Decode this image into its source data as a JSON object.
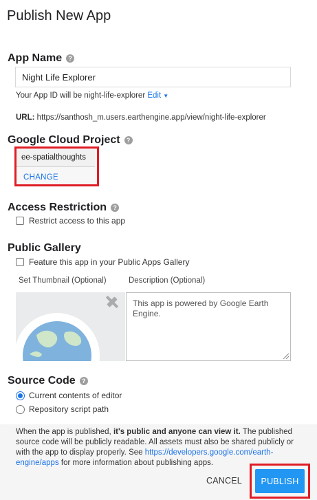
{
  "dialog": {
    "title": "Publish New App"
  },
  "app_name": {
    "heading": "App Name",
    "value": "Night Life Explorer",
    "id_prefix": "Your App ID will be night-life-explorer",
    "edit_label": "Edit",
    "url_label": "URL:",
    "url_value": "https://santhosh_m.users.earthengine.app/view/night-life-explorer"
  },
  "cloud_project": {
    "heading": "Google Cloud Project",
    "project_id": "ee-spatialthoughts",
    "change_label": "CHANGE"
  },
  "access": {
    "heading": "Access Restriction",
    "checkbox_label": "Restrict access to this app"
  },
  "gallery": {
    "heading": "Public Gallery",
    "checkbox_label": "Feature this app in your Public Apps Gallery",
    "thumbnail_label": "Set Thumbnail (Optional)",
    "description_label": "Description (Optional)",
    "description_placeholder": "This app is powered by Google Earth Engine."
  },
  "source_code": {
    "heading": "Source Code",
    "options": [
      {
        "label": "Current contents of editor",
        "selected": true
      },
      {
        "label": "Repository script path",
        "selected": false
      }
    ]
  },
  "footer": {
    "notice_part1": "When the app is published,",
    "notice_bold": "it's public and anyone can view it.",
    "notice_part2": "The published source code will be publicly readable. All assets must also be shared publicly or with the app to display properly. See",
    "notice_link": "https://developers.google.com/earth-engine/apps",
    "notice_part3": "for more information about publishing apps.",
    "cancel_label": "CANCEL",
    "publish_label": "PUBLISH"
  },
  "colors": {
    "accent": "#1a73e8",
    "publish_button": "#2196f3",
    "highlight_box": "#e01b24"
  }
}
